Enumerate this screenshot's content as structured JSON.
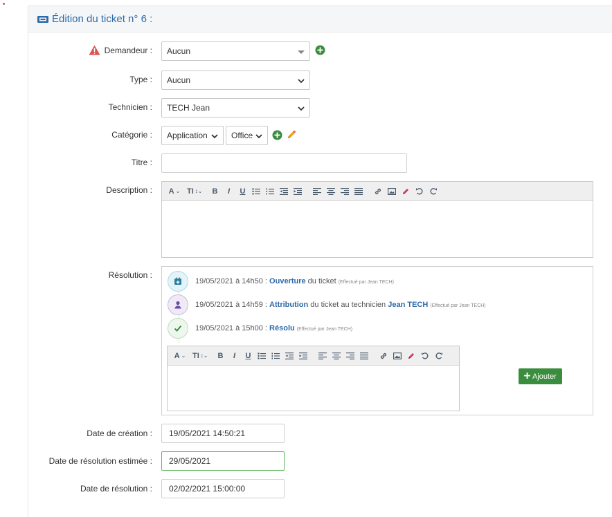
{
  "header": {
    "title": "Édition du ticket n° 6 :"
  },
  "form": {
    "requester": {
      "label": "Demandeur :",
      "value": "Aucun"
    },
    "type": {
      "label": "Type :",
      "value": "Aucun"
    },
    "technician": {
      "label": "Technicien :",
      "value": "TECH Jean"
    },
    "category": {
      "label": "Catégorie :",
      "value": "Application",
      "subvalue": "Office"
    },
    "title": {
      "label": "Titre :",
      "value": ""
    },
    "description": {
      "label": "Description :"
    },
    "resolution": {
      "label": "Résolution :"
    },
    "creation_date": {
      "label": "Date de création :",
      "value": "19/05/2021 14:50:21"
    },
    "estimated_resolution_date": {
      "label": "Date de résolution estimée :",
      "value": "29/05/2021"
    },
    "resolution_date": {
      "label": "Date de résolution :",
      "value": "02/02/2021 15:00:00"
    }
  },
  "timeline": [
    {
      "date": "19/05/2021 à 14h50 :",
      "action": "Ouverture",
      "rest": " du ticket",
      "person": "",
      "by": "(Effectué par Jean TECH)",
      "color": "#2aa9c9"
    },
    {
      "date": "19/05/2021 à 14h59 :",
      "action": "Attribution",
      "rest": " du ticket au technicien ",
      "person": "Jean TECH",
      "by": "(Effectué par Jean TECH)",
      "color": "#6a4fa6"
    },
    {
      "date": "19/05/2021 à 15h00 :",
      "action": "Résolu",
      "rest": "",
      "person": "",
      "by": "(Effectué par Jean TECH)",
      "color": "#3b8d3e"
    }
  ],
  "toolbar": {
    "font": "A",
    "size": "TI",
    "bold": "B",
    "italic": "I",
    "underline": "U"
  },
  "buttons": {
    "add": "Ajouter"
  },
  "icons": [
    "ticket-icon",
    "warning-icon",
    "plus-circle-icon",
    "pencil-icon",
    "calendar-icon",
    "user-icon",
    "check-icon"
  ],
  "colors": {
    "accent": "#2c6aa8",
    "success": "#3b8d3e",
    "warning": "#d9534f",
    "pencil": "#f0a020"
  }
}
